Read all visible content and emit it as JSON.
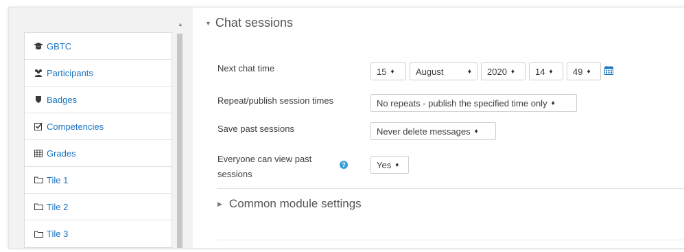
{
  "nav": {
    "items": [
      {
        "label": "GBTC",
        "icon": "graduation-cap-icon"
      },
      {
        "label": "Participants",
        "icon": "users-icon"
      },
      {
        "label": "Badges",
        "icon": "shield-icon"
      },
      {
        "label": "Competencies",
        "icon": "check-square-icon"
      },
      {
        "label": "Grades",
        "icon": "table-icon"
      },
      {
        "label": "Tile 1",
        "icon": "folder-icon"
      },
      {
        "label": "Tile 2",
        "icon": "folder-icon"
      },
      {
        "label": "Tile 3",
        "icon": "folder-icon"
      }
    ]
  },
  "section": {
    "title": "Chat sessions",
    "common_title": "Common module settings"
  },
  "fields": {
    "next_chat_time": {
      "label": "Next chat time",
      "day": "15",
      "month": "August",
      "year": "2020",
      "hour": "14",
      "minute": "49"
    },
    "repeat": {
      "label": "Repeat/publish session times",
      "value": "No repeats - publish the specified time only"
    },
    "save_past": {
      "label": "Save past sessions",
      "value": "Never delete messages"
    },
    "everyone_view": {
      "label_line1": "Everyone can view past",
      "label_line2": "sessions",
      "value": "Yes"
    }
  },
  "colors": {
    "link": "#1a73c1",
    "help": "#3aa0d8"
  }
}
